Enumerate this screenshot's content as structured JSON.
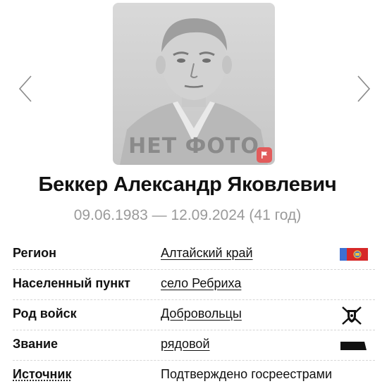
{
  "gallery": {
    "no_photo_label": "НЕТ ФОТО"
  },
  "person": {
    "name": "Беккер Александр Яковлевич",
    "dates": "09.06.1983 — 12.09.2024 (41 год)"
  },
  "details": [
    {
      "label": "Регион",
      "value": "Алтайский край",
      "icon": "altai-flag-icon"
    },
    {
      "label": "Населенный пункт",
      "value": "село Ребриха",
      "icon": ""
    },
    {
      "label": "Род войск",
      "value": "Добровольцы",
      "icon": "volunteers-emblem-icon"
    },
    {
      "label": "Звание",
      "value": "рядовой",
      "icon": "rank-insignia-icon"
    },
    {
      "label": "Источник",
      "value": "Подтверждено госреестрами",
      "icon": ""
    }
  ],
  "colors": {
    "muted_text": "#9a9a9a",
    "flag_badge": "#e25b5b",
    "flag_blue": "#3d6fd1",
    "flag_red": "#d62828"
  }
}
